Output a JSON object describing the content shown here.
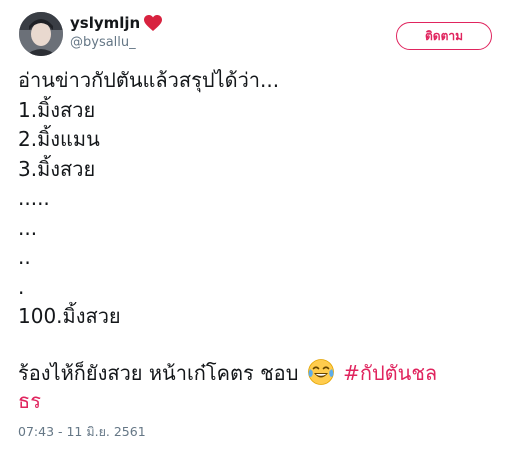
{
  "user": {
    "display_name": "yslymljn",
    "handle": "@bysallu_"
  },
  "follow_button": {
    "label": "ติดตาม"
  },
  "tweet": {
    "lines": [
      "อ่านข่าวกัปตันแล้วสรุปได้ว่า...",
      "1.มิ้งสวย",
      "2.มิ้งแมน",
      "3.มิ้งสวย",
      ".....",
      "...",
      "..",
      ".",
      "100.มิ้งสวย"
    ],
    "closing_text": "ร้องไห้ก็ยังสวย หน้าเก๋โคตร ชอบ",
    "hashtag_part1": "#กัปตันชล",
    "hashtag_part2": "ธร"
  },
  "timestamp": "07:43 - 11 มิ.ย. 2561",
  "colors": {
    "accent": "#e0245e",
    "text": "#14171a",
    "muted": "#657786"
  },
  "icons": {
    "heart": "red-heart-icon",
    "emoji": "face-with-tears-of-joy-icon"
  }
}
